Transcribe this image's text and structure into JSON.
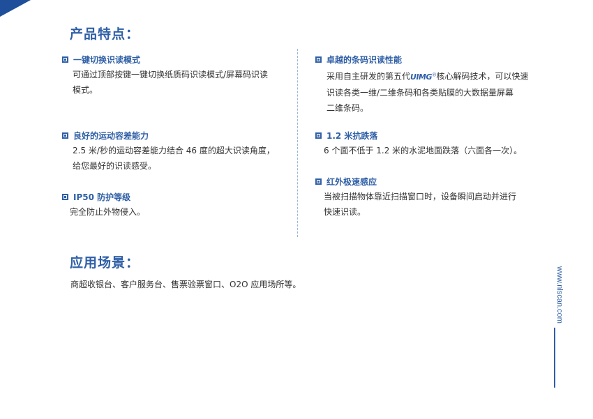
{
  "features_title": "产品特点：",
  "features_left": [
    {
      "title": "一键切换识读模式",
      "lines": [
        "可通过顶部按键一键切换纸质码识读模式/屏幕码识读",
        "模式。"
      ]
    },
    {
      "title": "良好的运动容差能力",
      "lines": [
        "2.5 米/秒的运动容差能力结合 46 度的超大识读角度，",
        "给您最好的识读感受。"
      ]
    },
    {
      "title": "IP50 防护等级",
      "lines": [
        "完全防止外物侵入。"
      ]
    }
  ],
  "features_right": [
    {
      "title": "卓越的条码识读性能",
      "line1_pre": "采用自主研发的第五代",
      "logo": "UIMG",
      "logo_mark": "®",
      "line1_post": "核心解码技术，可以快速",
      "lines": [
        "识读各类一维/二维条码和各类贴膜的大数据量屏幕",
        "二维条码。"
      ]
    },
    {
      "title": "1.2 米抗跌落",
      "lines": [
        "6 个面不低于 1.2 米的水泥地面跌落（六面各一次）。"
      ]
    },
    {
      "title": "红外极速感应",
      "lines": [
        "当被扫描物体靠近扫描窗口时，设备瞬间启动并进行",
        "快速识读。"
      ]
    }
  ],
  "application_title": "应用场景：",
  "application_text": "商超收银台、客户服务台、售票验票窗口、O2O 应用场所等。",
  "site_url": "www.nlscan.com"
}
